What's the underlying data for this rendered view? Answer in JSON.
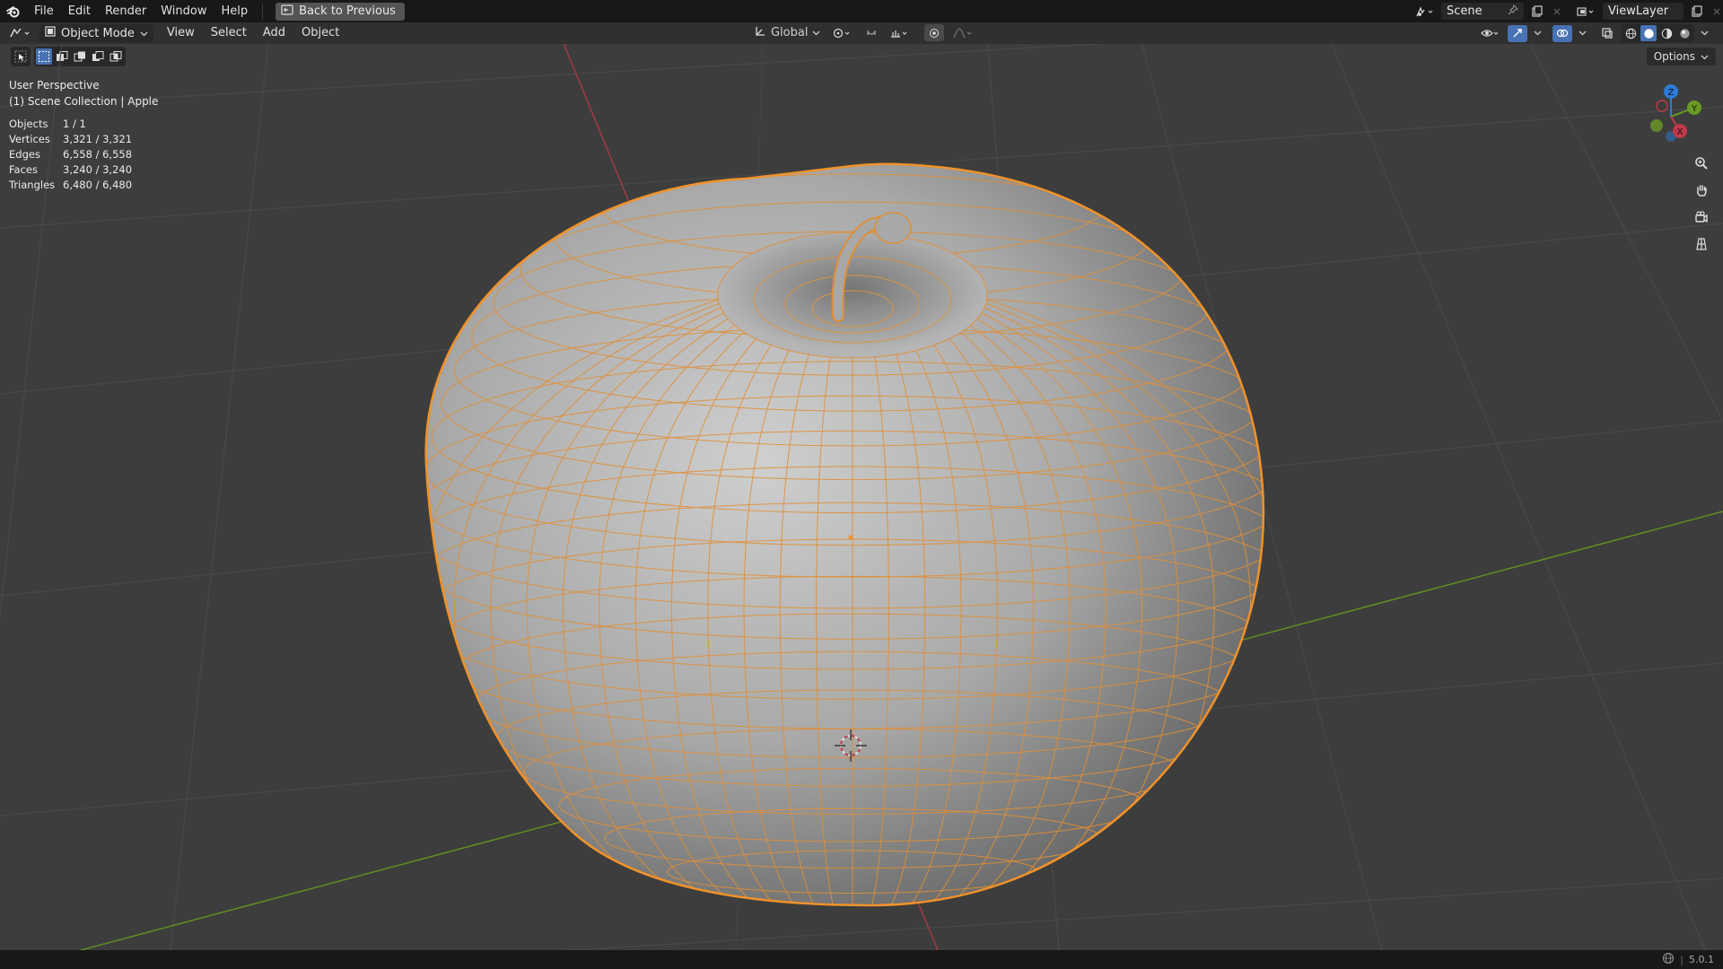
{
  "topbar": {
    "menus": [
      "File",
      "Edit",
      "Render",
      "Window",
      "Help"
    ],
    "back_label": "Back to Previous",
    "scene_name": "Scene",
    "view_layer": "ViewLayer"
  },
  "header": {
    "mode": "Object Mode",
    "menus": [
      "View",
      "Select",
      "Add",
      "Object"
    ],
    "transform_orientation": "Global",
    "options_label": "Options"
  },
  "viewport": {
    "perspective": "User Perspective",
    "collection": "(1) Scene Collection | Apple",
    "stats": [
      {
        "key": "Objects",
        "value": "1 / 1"
      },
      {
        "key": "Vertices",
        "value": "3,321 / 3,321"
      },
      {
        "key": "Edges",
        "value": "6,558 / 6,558"
      },
      {
        "key": "Faces",
        "value": "3,240 / 3,240"
      },
      {
        "key": "Triangles",
        "value": "6,480 / 6,480"
      }
    ],
    "gizmo_axes": {
      "x": "X",
      "y": "Y",
      "z": "Z"
    }
  },
  "status": {
    "version": "5.0.1"
  },
  "colors": {
    "selection": "#f0922a",
    "x_axis": "#c0394b",
    "y_axis": "#6a9a25",
    "z_axis": "#2d7bd8",
    "grid": "#4a4a4a",
    "background": "#3d3d3d"
  }
}
